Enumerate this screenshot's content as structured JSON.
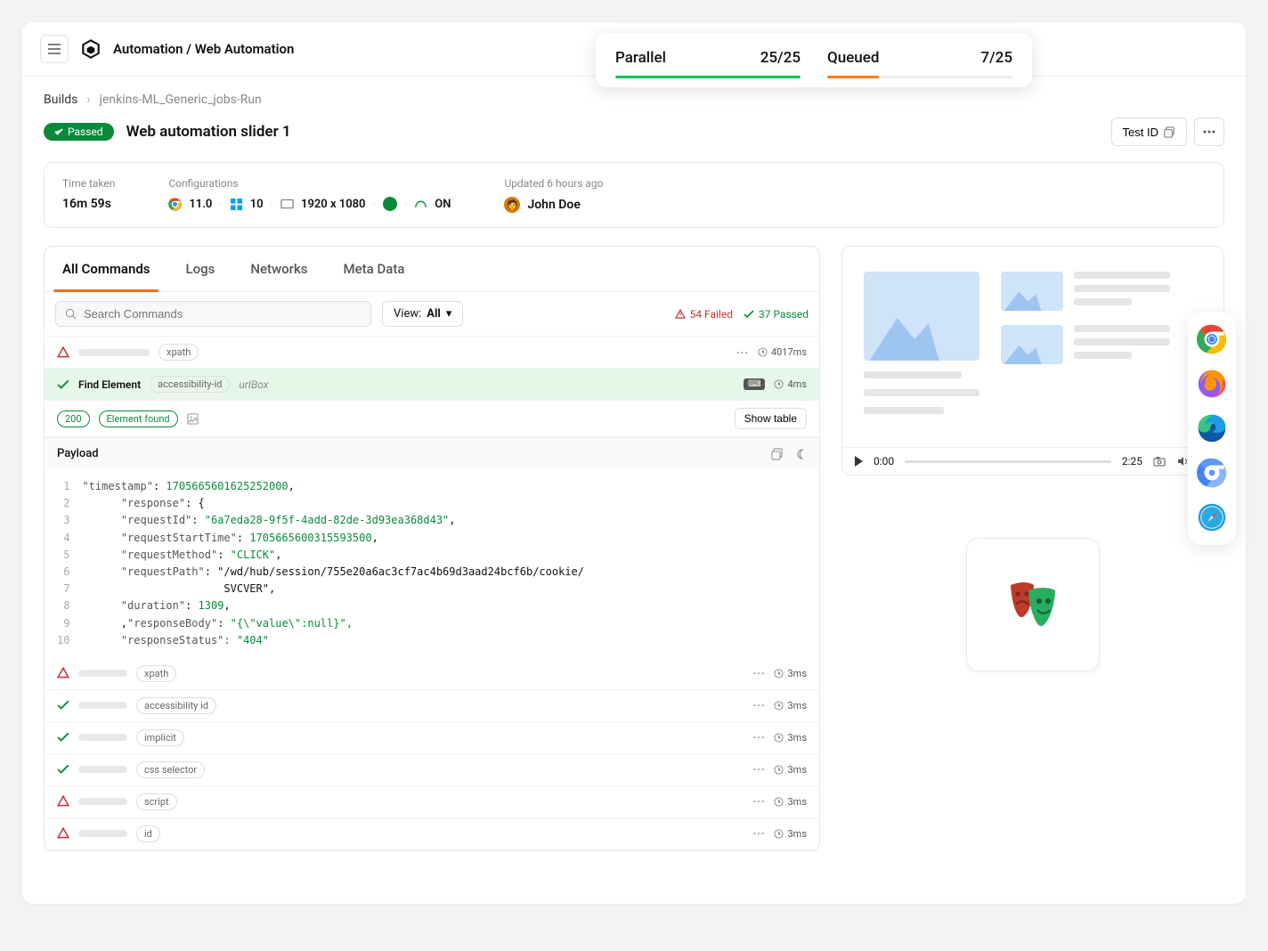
{
  "header": {
    "breadcrumb_title": "Automation / Web Automation"
  },
  "floating": {
    "parallel": {
      "label": "Parallel",
      "value": "25/25",
      "pct": 100,
      "color": "#1abc5b"
    },
    "queued": {
      "label": "Queued",
      "value": "7/25",
      "pct": 28,
      "color": "#ff7a1a"
    }
  },
  "breadcrumb": {
    "root": "Builds",
    "current": "jenkins-ML_Generic_jobs-Run"
  },
  "title": {
    "status": "Passed",
    "name": "Web automation slider 1",
    "test_id_btn": "Test ID"
  },
  "meta": {
    "time_label": "Time taken",
    "time_value": "16m 59s",
    "config_label": "Configurations",
    "cfg": {
      "browser_ver": "11.0",
      "os_ver": "10",
      "resolution": "1920 x 1080",
      "tunnel": "ON"
    },
    "updated_label": "Updated 6 hours ago",
    "author": "John Doe"
  },
  "tabs": [
    "All Commands",
    "Logs",
    "Networks",
    "Meta Data"
  ],
  "search_placeholder": "Search Commands",
  "view": {
    "label": "View:",
    "value": "All"
  },
  "counts": {
    "failed": "54 Failed",
    "passed": "37 Passed"
  },
  "rows": [
    {
      "status": "fail",
      "pill": "xpath",
      "time": "4017ms"
    },
    {
      "status": "pass",
      "name": "Find Element",
      "pill": "accessibility-id",
      "url": "urIBox",
      "time": "4ms",
      "hl": true
    },
    {
      "sub": true,
      "code": "200",
      "msg": "Element found",
      "btn": "Show table"
    },
    {
      "status": "fail",
      "pill": "xpath",
      "time": "3ms"
    },
    {
      "status": "pass",
      "pill": "accessibility id",
      "time": "3ms"
    },
    {
      "status": "pass",
      "pill": "implicit",
      "time": "3ms"
    },
    {
      "status": "pass",
      "pill": "css selector",
      "time": "3ms"
    },
    {
      "status": "fail",
      "pill": "script",
      "time": "3ms"
    },
    {
      "status": "fail",
      "pill": "id",
      "time": "3ms"
    }
  ],
  "payload": {
    "title": "Payload",
    "lines": [
      "\"timestamp\": 1705665601625252000,",
      "      \"response\": {",
      "      \"requestId\": \"6a7eda28-9f5f-4add-82de-3d93ea368d43\",",
      "      \"requestStartTime\": 1705665600315593500,",
      "      \"requestMethod\": \"CLICK\",",
      "      \"requestPath\": \"/wd/hub/session/755e20a6ac3cf7ac4b69d3aad24bcf6b/cookie/",
      "                      SVCVER\",",
      "      \"duration\": 1309,",
      "      ,\"responseBody\": \"{\\\"value\\\":null}\",",
      "      \"responseStatus\": \"404\""
    ],
    "line_numbers": [
      "1",
      "2",
      "3",
      "4",
      "5",
      "6",
      "7",
      "8",
      "9",
      "10"
    ]
  },
  "video": {
    "cur": "0:00",
    "dur": "2:25"
  },
  "browsers": [
    "chrome",
    "firefox",
    "edge",
    "chromium",
    "safari"
  ]
}
